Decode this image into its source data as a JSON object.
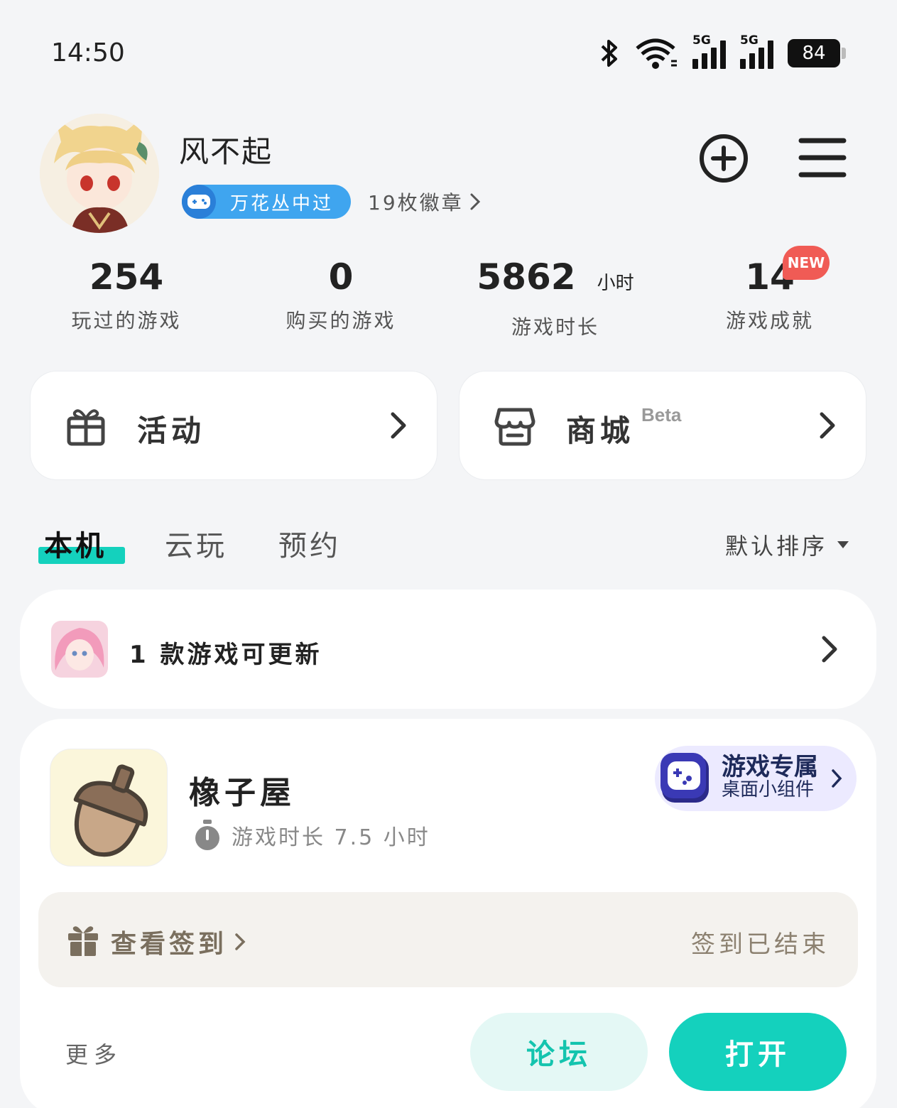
{
  "status_bar": {
    "time": "14:50",
    "icons": [
      "bluetooth-icon",
      "wifi-icon",
      "signal-5g-icon",
      "signal-5g-icon",
      "battery-icon"
    ],
    "network_label": "5G",
    "battery": "84"
  },
  "profile": {
    "username": "风不起",
    "badge_label": "万花丛中过",
    "medals": "19枚徽章"
  },
  "stats": [
    {
      "value": "254",
      "unit": "",
      "label": "玩过的游戏"
    },
    {
      "value": "0",
      "unit": "",
      "label": "购买的游戏"
    },
    {
      "value": "5862",
      "unit": "小时",
      "label": "游戏时长"
    },
    {
      "value": "14",
      "unit": "",
      "label": "游戏成就",
      "badge": "NEW"
    }
  ],
  "cards": {
    "activity": {
      "label": "活动",
      "icon": "gift-icon"
    },
    "shop": {
      "label": "商城",
      "tag": "Beta",
      "icon": "store-icon"
    }
  },
  "tabs": [
    {
      "label": "本机",
      "active": true
    },
    {
      "label": "云玩",
      "active": false
    },
    {
      "label": "预约",
      "active": false
    }
  ],
  "sort": {
    "label": "默认排序"
  },
  "update": {
    "text": "1 款游戏可更新"
  },
  "game": {
    "name": "橡子屋",
    "play_time": "游戏时长 7.5 小时",
    "widget_title": "游戏专属",
    "widget_sub": "桌面小组件",
    "signin_label": "查看签到",
    "signin_status": "签到已结束",
    "more": "更多",
    "forum": "论坛",
    "open": "打开"
  },
  "colors": {
    "accent": "#14d1bd",
    "badge_blue": "#3fa5ef",
    "new_red": "#f05b55",
    "background": "#f4f5f7"
  }
}
